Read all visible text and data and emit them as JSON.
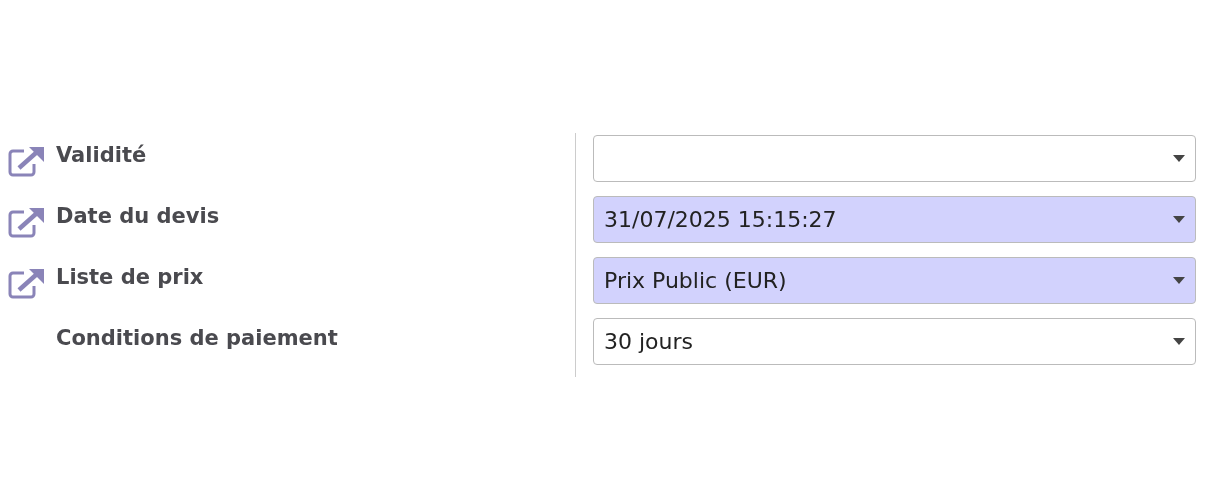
{
  "fields": [
    {
      "label": "Validité",
      "link_icon": true,
      "highlighted": false
    },
    {
      "label": "Date du devis",
      "link_icon": true,
      "highlighted": true,
      "value": "31/07/2025 15:15:27"
    },
    {
      "label": "Liste de prix",
      "link_icon": true,
      "highlighted": true,
      "value": "Prix Public (EUR)"
    },
    {
      "label": "Conditions de paiement",
      "link_icon": false,
      "highlighted": false,
      "value": "30 jours"
    }
  ]
}
